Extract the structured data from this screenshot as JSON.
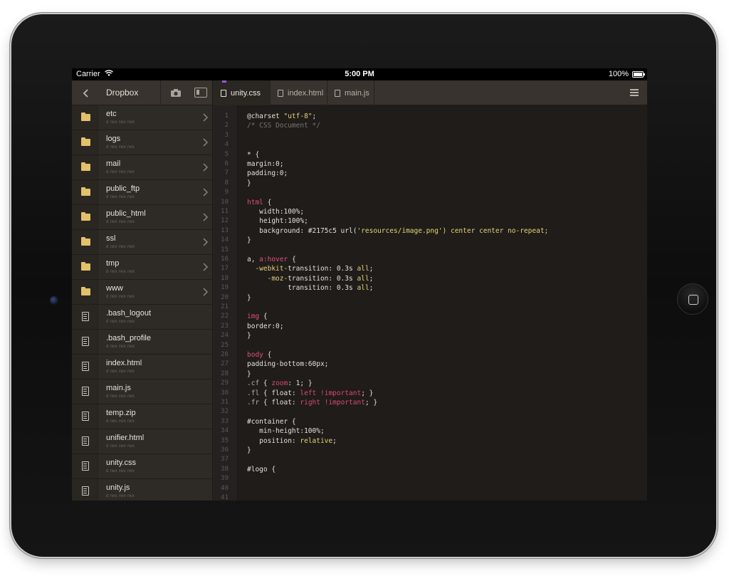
{
  "status_bar": {
    "carrier": "Carrier",
    "time": "5:00 PM",
    "battery": "100%"
  },
  "sidebar": {
    "title": "Dropbox",
    "items": [
      {
        "name": "etc",
        "perm": "d rwx rwx rwx",
        "type": "folder"
      },
      {
        "name": "logs",
        "perm": "d rwx rwx rwx",
        "type": "folder"
      },
      {
        "name": "mail",
        "perm": "d rwx rwx rwx",
        "type": "folder"
      },
      {
        "name": "public_ftp",
        "perm": "d rwx rwx rwx",
        "type": "folder"
      },
      {
        "name": "public_html",
        "perm": "d rwx rwx rwx",
        "type": "folder"
      },
      {
        "name": "ssl",
        "perm": "d rwx rwx rwx",
        "type": "folder"
      },
      {
        "name": "tmp",
        "perm": "d rwx rwx rwx",
        "type": "folder"
      },
      {
        "name": "www",
        "perm": "d rwx rwx rwx",
        "type": "folder"
      },
      {
        "name": ".bash_logout",
        "perm": "d rwx rwx rwx",
        "type": "file"
      },
      {
        "name": ".bash_profile",
        "perm": "d rwx rwx rwx",
        "type": "file"
      },
      {
        "name": "index.html",
        "perm": "d rwx rwx rwx",
        "type": "file"
      },
      {
        "name": "main.js",
        "perm": "d rwx rwx rwx",
        "type": "file"
      },
      {
        "name": "temp.zip",
        "perm": "d rwx rwx rwx",
        "type": "file"
      },
      {
        "name": "unifier.html",
        "perm": "d rwx rwx rwx",
        "type": "file"
      },
      {
        "name": "unity.css",
        "perm": "d rwx rwx rwx",
        "type": "file"
      },
      {
        "name": "unity.js",
        "perm": "d rwx rwx rwx",
        "type": "file"
      }
    ]
  },
  "tabs": [
    {
      "label": "unity.css",
      "active": true
    },
    {
      "label": "index.html",
      "active": false
    },
    {
      "label": "main.js",
      "active": false
    }
  ],
  "line_numbers": [
    "1",
    "2",
    "3",
    "4",
    "5",
    "6",
    "7",
    "8",
    "9",
    "10",
    "11",
    "12",
    "13",
    "14",
    "15",
    "16",
    "17",
    "18",
    "19",
    "20",
    "21",
    "22",
    "23",
    "24",
    "25",
    "26",
    "27",
    "28",
    "29",
    "30",
    "31",
    "32",
    "33",
    "34",
    "35",
    "36",
    "37",
    "38",
    "39",
    "40",
    "41"
  ],
  "code_lines": [
    [
      {
        "t": "@charset ",
        "c": "prop"
      },
      {
        "t": "\"utf-8\"",
        "c": "string"
      },
      {
        "t": ";",
        "c": "prop"
      }
    ],
    [
      {
        "t": "/* CSS Document */",
        "c": "comment"
      }
    ],
    [],
    [],
    [
      {
        "t": "* {",
        "c": "prop"
      }
    ],
    [
      {
        "t": "margin:0;",
        "c": "prop"
      }
    ],
    [
      {
        "t": "padding:0;",
        "c": "prop"
      }
    ],
    [
      {
        "t": "}",
        "c": "prop"
      }
    ],
    [],
    [
      {
        "t": "html",
        "c": "tag"
      },
      {
        "t": " {",
        "c": "prop"
      }
    ],
    [
      {
        "t": "   width:100%;",
        "c": "prop"
      }
    ],
    [
      {
        "t": "   height:100%;",
        "c": "prop"
      }
    ],
    [
      {
        "t": "   background: #2175c5 url(",
        "c": "prop"
      },
      {
        "t": "'resources/image.png'",
        "c": "string"
      },
      {
        "t": ") center center no-repeat;",
        "c": "val"
      }
    ],
    [
      {
        "t": "}",
        "c": "prop"
      }
    ],
    [],
    [
      {
        "t": "a, ",
        "c": "prop"
      },
      {
        "t": "a:hover",
        "c": "tag"
      },
      {
        "t": " {",
        "c": "prop"
      }
    ],
    [
      {
        "t": "  -webkit-",
        "c": "val"
      },
      {
        "t": "transition: 0.3s ",
        "c": "prop"
      },
      {
        "t": "all",
        "c": "val"
      },
      {
        "t": ";",
        "c": "prop"
      }
    ],
    [
      {
        "t": "     -moz-",
        "c": "val"
      },
      {
        "t": "transition: 0.3s ",
        "c": "prop"
      },
      {
        "t": "all",
        "c": "val"
      },
      {
        "t": ";",
        "c": "prop"
      }
    ],
    [
      {
        "t": "          transition: 0.3s ",
        "c": "prop"
      },
      {
        "t": "all",
        "c": "val"
      },
      {
        "t": ";",
        "c": "prop"
      }
    ],
    [
      {
        "t": "}",
        "c": "prop"
      }
    ],
    [],
    [
      {
        "t": "img",
        "c": "tag"
      },
      {
        "t": " {",
        "c": "prop"
      }
    ],
    [
      {
        "t": "border:0;",
        "c": "prop"
      }
    ],
    [
      {
        "t": "}",
        "c": "prop"
      }
    ],
    [],
    [
      {
        "t": "body",
        "c": "tag"
      },
      {
        "t": " {",
        "c": "prop"
      }
    ],
    [
      {
        "t": "padding-bottom:60px;",
        "c": "prop"
      }
    ],
    [
      {
        "t": "}",
        "c": "prop"
      }
    ],
    [
      {
        "t": ".cf",
        "c": "sel"
      },
      {
        "t": " { ",
        "c": "prop"
      },
      {
        "t": "zoom",
        "c": "kw"
      },
      {
        "t": ": 1; }",
        "c": "prop"
      }
    ],
    [
      {
        "t": ".fl",
        "c": "sel"
      },
      {
        "t": " { float: ",
        "c": "prop"
      },
      {
        "t": "left",
        "c": "kw"
      },
      {
        "t": " ",
        "c": "prop"
      },
      {
        "t": "!important",
        "c": "kw"
      },
      {
        "t": "; }",
        "c": "prop"
      }
    ],
    [
      {
        "t": ".fr",
        "c": "sel"
      },
      {
        "t": " { float: ",
        "c": "prop"
      },
      {
        "t": "right",
        "c": "kw"
      },
      {
        "t": " ",
        "c": "prop"
      },
      {
        "t": "!important",
        "c": "kw"
      },
      {
        "t": "; }",
        "c": "prop"
      }
    ],
    [],
    [
      {
        "t": "#container {",
        "c": "prop"
      }
    ],
    [
      {
        "t": "   min-height:100%;",
        "c": "prop"
      }
    ],
    [
      {
        "t": "   position: ",
        "c": "prop"
      },
      {
        "t": "relative",
        "c": "val"
      },
      {
        "t": ";",
        "c": "prop"
      }
    ],
    [
      {
        "t": "}",
        "c": "prop"
      }
    ],
    [],
    [
      {
        "t": "#logo {",
        "c": "prop"
      }
    ],
    [],
    [],
    []
  ]
}
